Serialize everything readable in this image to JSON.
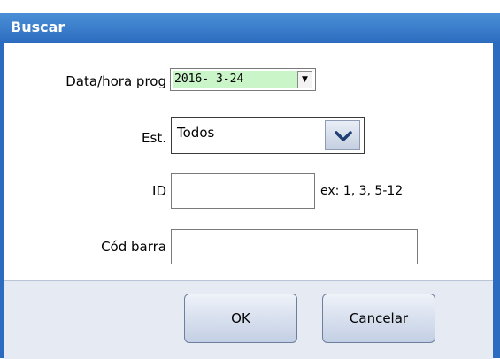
{
  "dialog": {
    "title": "Buscar"
  },
  "form": {
    "datetime": {
      "label": "Data/hora prog",
      "value": "2016- 3-24"
    },
    "status": {
      "label": "Est.",
      "selected": "Todos"
    },
    "id": {
      "label": "ID",
      "value": "",
      "hint": "ex: 1, 3, 5-12"
    },
    "barcode": {
      "label": "Cód barra",
      "value": ""
    }
  },
  "buttons": {
    "ok": "OK",
    "cancel": "Cancelar"
  },
  "colors": {
    "titlebar": "#2c6cc0",
    "date_highlight": "#c9f5c9",
    "footer": "#e6ebf3"
  }
}
